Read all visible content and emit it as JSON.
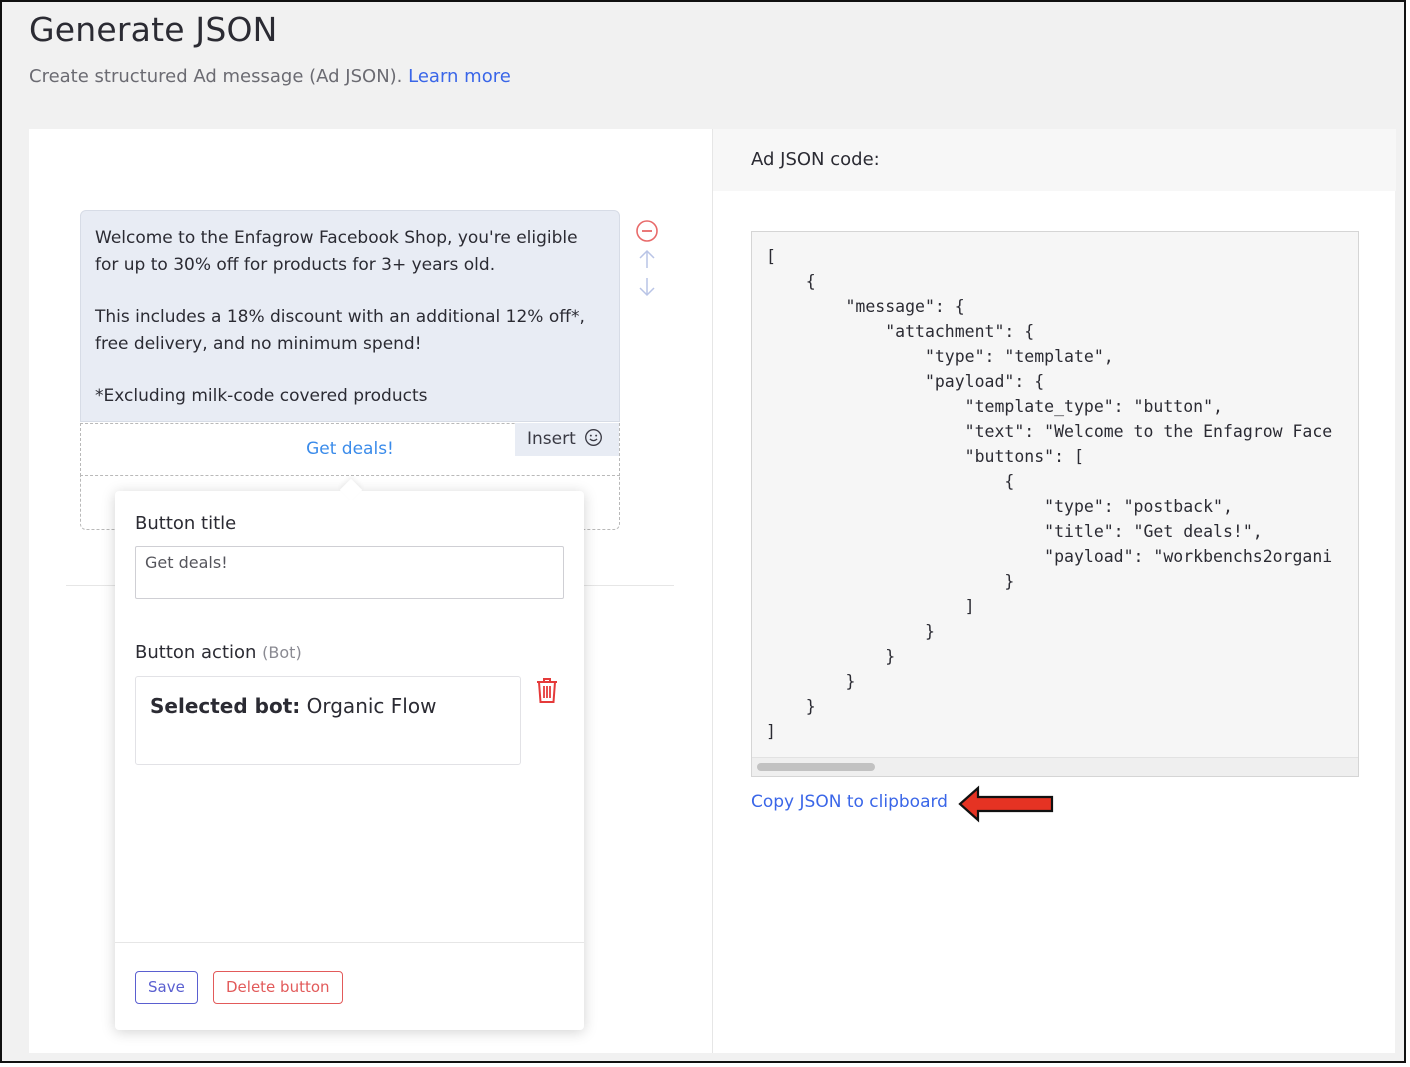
{
  "header": {
    "title": "Generate JSON",
    "subtitle": "Create structured Ad message (Ad JSON).",
    "learn_more": "Learn more"
  },
  "message": {
    "paragraphs": [
      "Welcome to the Enfagrow Facebook Shop, you're eligible for up to 30% off for products for 3+ years old.",
      "This includes a 18% discount with an additional 12% off*, free delivery, and no minimum spend!",
      "*Excluding milk-code covered products"
    ],
    "button_label": "Get deals!",
    "insert_label": "Insert"
  },
  "popover": {
    "button_title_label": "Button title",
    "button_title_value": "Get deals!",
    "button_action_label": "Button action",
    "button_action_hint": "(Bot)",
    "selected_bot_prefix": "Selected bot:",
    "selected_bot_name": "Organic Flow",
    "save_label": "Save",
    "delete_label": "Delete button"
  },
  "code_panel": {
    "header": "Ad JSON code:",
    "code": "[\n    {\n        \"message\": {\n            \"attachment\": {\n                \"type\": \"template\",\n                \"payload\": {\n                    \"template_type\": \"button\",\n                    \"text\": \"Welcome to the Enfagrow Face\n                    \"buttons\": [\n                        {\n                            \"type\": \"postback\",\n                            \"title\": \"Get deals!\",\n                            \"payload\": \"workbenchs2organi\n                        }\n                    ]\n                }\n            }\n        }\n    }\n]",
    "copy_label": "Copy JSON to clipboard"
  },
  "icons": {
    "remove": "minus-circle-icon",
    "move_up": "arrow-up-icon",
    "move_down": "arrow-down-icon",
    "emoji": "smiley-icon",
    "delete": "trash-icon"
  },
  "colors": {
    "accent_blue": "#3a66e8",
    "danger_red": "#e25a5a",
    "bubble_bg": "#e8ecf4",
    "annotation_arrow": "#e53323"
  }
}
